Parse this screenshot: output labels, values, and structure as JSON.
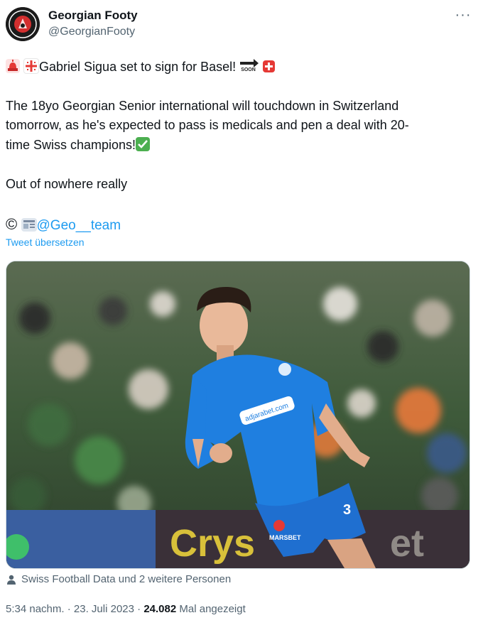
{
  "author": {
    "name": "Georgian Footy",
    "handle": "@GeorgianFooty",
    "avatar_text": "GEORGIAN FOOTY"
  },
  "tweet": {
    "line1": "Gabriel Sigua set to sign for Basel!",
    "soon_label": "SOON",
    "para2_line1": "The 18yo Georgian Senior international will touchdown in Switzerland",
    "para2_line2": "tomorrow, as he's expected to pass is medicals and pen a deal with 20-",
    "para2_line3": "time Swiss champions!",
    "para3": "Out of nowhere really",
    "credit_symbol": "©",
    "credit_mention": "@Geo__team"
  },
  "translate_label": "Tweet übersetzen",
  "media": {
    "shirt_sponsor": "adjarabet.com",
    "shorts_sponsor": "MARSBET",
    "shirt_number": "3",
    "board_text_left": "Crys",
    "board_text_right": "et"
  },
  "tagged_label": "Swiss Football Data und 2 weitere Personen",
  "meta": {
    "time": "5:34 nachm.",
    "sep1": " · ",
    "date": "23. Juli 2023",
    "sep2": " · ",
    "views": "24.082",
    "views_label": " Mal angezeigt"
  },
  "colors": {
    "link": "#1d9bf0",
    "secondary": "#536471",
    "jersey": "#1f7fe0"
  }
}
